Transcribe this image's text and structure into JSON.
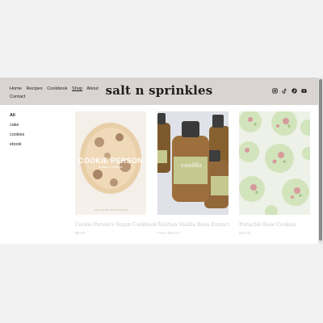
{
  "header": {
    "nav": [
      "Home",
      "Recipes",
      "Cookbook",
      "Shop",
      "About",
      "Contact"
    ],
    "active_nav": "Shop",
    "logo": "salt n sprinkles",
    "social_icons": [
      "instagram-icon",
      "tiktok-icon",
      "pinterest-icon",
      "youtube-icon"
    ]
  },
  "sidebar": {
    "categories": [
      "All",
      "cake",
      "cookies",
      "ebook"
    ],
    "selected": "All"
  },
  "products": [
    {
      "name": "Cookie Person's Vegan Cookbook",
      "price": "$9.99",
      "cover_title": "COOKIE PERSON",
      "cover_subtitle": "a vegan cookbook",
      "cover_footer": "more cookies, less everything"
    },
    {
      "name": "Tahitian Vanilla Bean Extract",
      "price": "From $15.00",
      "label_text": "vanilla"
    },
    {
      "name": "Pistachio Rose Cookies",
      "price": "$12.00"
    }
  ],
  "colors": {
    "header_bg": "#d9d4d1",
    "page_bg": "#f2f2f2",
    "faded_text": "#c9c9c9"
  }
}
